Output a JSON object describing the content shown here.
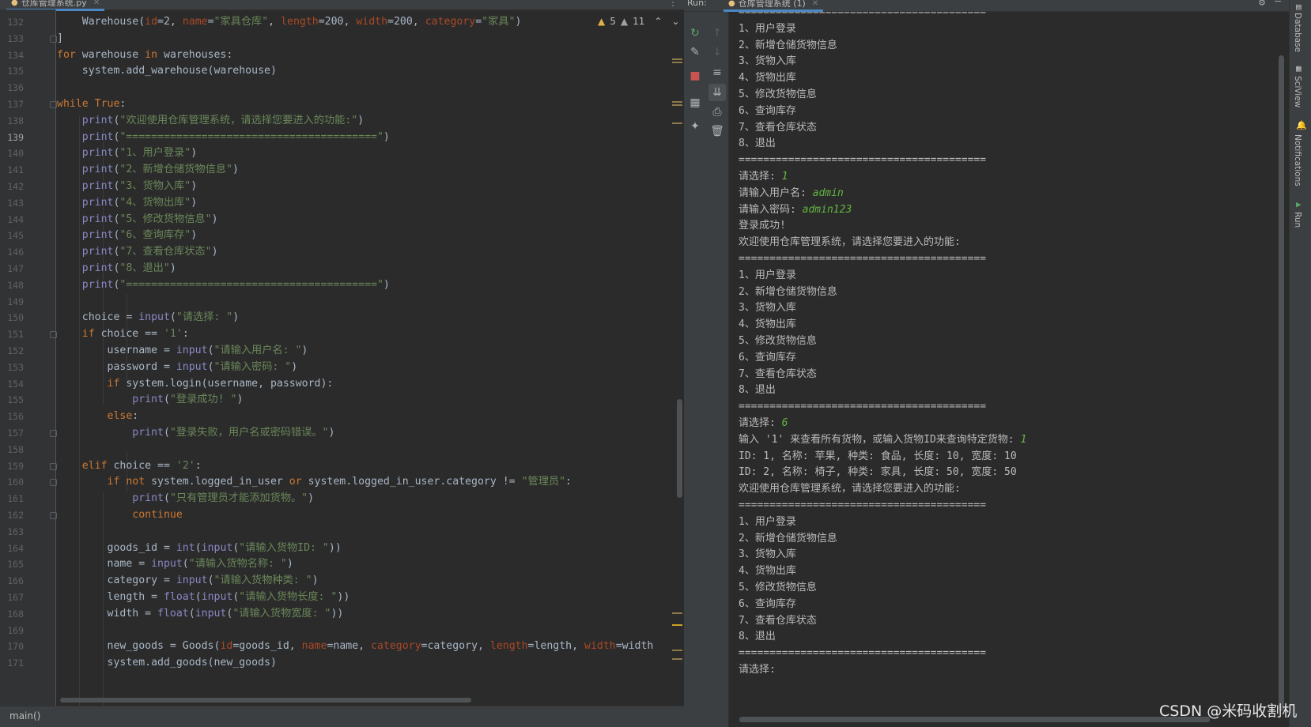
{
  "editor": {
    "tab_label": "仓库管理系统.py",
    "inspection": {
      "warnings": "5",
      "weak_warnings": "11"
    },
    "breadcrumb": "main()",
    "line_numbers": [
      "132",
      "133",
      "134",
      "135",
      "136",
      "137",
      "138",
      "139",
      "140",
      "141",
      "142",
      "143",
      "144",
      "145",
      "146",
      "147",
      "148",
      "149",
      "150",
      "151",
      "152",
      "153",
      "154",
      "155",
      "156",
      "157",
      "158",
      "159",
      "160",
      "161",
      "162",
      "163",
      "164",
      "165",
      "166",
      "167",
      "168",
      "169",
      "170",
      "171"
    ],
    "code_lines": [
      {
        "s": [
          {
            "c": "df",
            "t": "    Warehouse("
          },
          {
            "c": "pm",
            "t": "id"
          },
          {
            "c": "df",
            "t": "=2, "
          },
          {
            "c": "pm",
            "t": "name"
          },
          {
            "c": "df",
            "t": "="
          },
          {
            "c": "st",
            "t": "\"家具仓库\""
          },
          {
            "c": "df",
            "t": ", "
          },
          {
            "c": "pm",
            "t": "length"
          },
          {
            "c": "df",
            "t": "=200, "
          },
          {
            "c": "pm",
            "t": "width"
          },
          {
            "c": "df",
            "t": "=200, "
          },
          {
            "c": "pm",
            "t": "category"
          },
          {
            "c": "df",
            "t": "="
          },
          {
            "c": "st",
            "t": "\"家具\""
          },
          {
            "c": "df",
            "t": ")"
          }
        ]
      },
      {
        "s": [
          {
            "c": "df",
            "t": "]"
          }
        ]
      },
      {
        "s": [
          {
            "c": "kw",
            "t": "for"
          },
          {
            "c": "df",
            "t": " warehouse "
          },
          {
            "c": "kw",
            "t": "in"
          },
          {
            "c": "df",
            "t": " warehouses:"
          }
        ]
      },
      {
        "s": [
          {
            "c": "df",
            "t": "    system.add_warehouse(warehouse)"
          }
        ]
      },
      {
        "s": []
      },
      {
        "s": [
          {
            "c": "kw",
            "t": "while"
          },
          {
            "c": "df",
            "t": " "
          },
          {
            "c": "kw",
            "t": "True"
          },
          {
            "c": "df",
            "t": ":"
          }
        ]
      },
      {
        "s": [
          {
            "c": "bi",
            "t": "    print"
          },
          {
            "c": "df",
            "t": "("
          },
          {
            "c": "st",
            "t": "\"欢迎使用仓库管理系统，请选择您要进入的功能:\""
          },
          {
            "c": "df",
            "t": ")"
          }
        ]
      },
      {
        "s": [
          {
            "c": "bi",
            "t": "    print"
          },
          {
            "c": "df",
            "t": "("
          },
          {
            "c": "st",
            "t": "\"========================================\""
          },
          {
            "c": "df",
            "t": ")"
          }
        ]
      },
      {
        "s": [
          {
            "c": "bi",
            "t": "    print"
          },
          {
            "c": "df",
            "t": "("
          },
          {
            "c": "st",
            "t": "\"1、用户登录\""
          },
          {
            "c": "df",
            "t": ")"
          }
        ]
      },
      {
        "s": [
          {
            "c": "bi",
            "t": "    print"
          },
          {
            "c": "df",
            "t": "("
          },
          {
            "c": "st",
            "t": "\"2、新增仓储货物信息\""
          },
          {
            "c": "df",
            "t": ")"
          }
        ]
      },
      {
        "s": [
          {
            "c": "bi",
            "t": "    print"
          },
          {
            "c": "df",
            "t": "("
          },
          {
            "c": "st",
            "t": "\"3、货物入库\""
          },
          {
            "c": "df",
            "t": ")"
          }
        ]
      },
      {
        "s": [
          {
            "c": "bi",
            "t": "    print"
          },
          {
            "c": "df",
            "t": "("
          },
          {
            "c": "st",
            "t": "\"4、货物出库\""
          },
          {
            "c": "df",
            "t": ")"
          }
        ]
      },
      {
        "s": [
          {
            "c": "bi",
            "t": "    print"
          },
          {
            "c": "df",
            "t": "("
          },
          {
            "c": "st",
            "t": "\"5、修改货物信息\""
          },
          {
            "c": "df",
            "t": ")"
          }
        ]
      },
      {
        "s": [
          {
            "c": "bi",
            "t": "    print"
          },
          {
            "c": "df",
            "t": "("
          },
          {
            "c": "st",
            "t": "\"6、查询库存\""
          },
          {
            "c": "df",
            "t": ")"
          }
        ]
      },
      {
        "s": [
          {
            "c": "bi",
            "t": "    print"
          },
          {
            "c": "df",
            "t": "("
          },
          {
            "c": "st",
            "t": "\"7、查看仓库状态\""
          },
          {
            "c": "df",
            "t": ")"
          }
        ]
      },
      {
        "s": [
          {
            "c": "bi",
            "t": "    print"
          },
          {
            "c": "df",
            "t": "("
          },
          {
            "c": "st",
            "t": "\"8、退出\""
          },
          {
            "c": "df",
            "t": ")"
          }
        ]
      },
      {
        "s": [
          {
            "c": "bi",
            "t": "    print"
          },
          {
            "c": "df",
            "t": "("
          },
          {
            "c": "st",
            "t": "\"========================================\""
          },
          {
            "c": "df",
            "t": ")"
          }
        ]
      },
      {
        "s": []
      },
      {
        "s": [
          {
            "c": "df",
            "t": "    choice = "
          },
          {
            "c": "bi",
            "t": "input"
          },
          {
            "c": "df",
            "t": "("
          },
          {
            "c": "st",
            "t": "\"请选择: \""
          },
          {
            "c": "df",
            "t": ")"
          }
        ]
      },
      {
        "s": [
          {
            "c": "kw",
            "t": "    if"
          },
          {
            "c": "df",
            "t": " choice == "
          },
          {
            "c": "st",
            "t": "'1'"
          },
          {
            "c": "df",
            "t": ":"
          }
        ]
      },
      {
        "s": [
          {
            "c": "df",
            "t": "        username = "
          },
          {
            "c": "bi",
            "t": "input"
          },
          {
            "c": "df",
            "t": "("
          },
          {
            "c": "st",
            "t": "\"请输入用户名: \""
          },
          {
            "c": "df",
            "t": ")"
          }
        ]
      },
      {
        "s": [
          {
            "c": "df",
            "t": "        password = "
          },
          {
            "c": "bi",
            "t": "input"
          },
          {
            "c": "df",
            "t": "("
          },
          {
            "c": "st",
            "t": "\"请输入密码: \""
          },
          {
            "c": "df",
            "t": ")"
          }
        ]
      },
      {
        "s": [
          {
            "c": "kw",
            "t": "        if"
          },
          {
            "c": "df",
            "t": " system.login(username, password):"
          }
        ]
      },
      {
        "s": [
          {
            "c": "bi",
            "t": "            print"
          },
          {
            "c": "df",
            "t": "("
          },
          {
            "c": "st",
            "t": "\"登录成功! \""
          },
          {
            "c": "df",
            "t": ")"
          }
        ]
      },
      {
        "s": [
          {
            "c": "kw",
            "t": "        else"
          },
          {
            "c": "df",
            "t": ":"
          }
        ]
      },
      {
        "s": [
          {
            "c": "bi",
            "t": "            print"
          },
          {
            "c": "df",
            "t": "("
          },
          {
            "c": "st",
            "t": "\"登录失败，用户名或密码错误。\""
          },
          {
            "c": "df",
            "t": ")"
          }
        ]
      },
      {
        "s": []
      },
      {
        "s": [
          {
            "c": "kw",
            "t": "    elif"
          },
          {
            "c": "df",
            "t": " choice == "
          },
          {
            "c": "st",
            "t": "'2'"
          },
          {
            "c": "df",
            "t": ":"
          }
        ]
      },
      {
        "s": [
          {
            "c": "kw",
            "t": "        if not"
          },
          {
            "c": "df",
            "t": " system.logged_in_user "
          },
          {
            "c": "kw",
            "t": "or"
          },
          {
            "c": "df",
            "t": " system.logged_in_user.category != "
          },
          {
            "c": "st",
            "t": "\"管理员\""
          },
          {
            "c": "df",
            "t": ":"
          }
        ]
      },
      {
        "s": [
          {
            "c": "bi",
            "t": "            print"
          },
          {
            "c": "df",
            "t": "("
          },
          {
            "c": "st",
            "t": "\"只有管理员才能添加货物。\""
          },
          {
            "c": "df",
            "t": ")"
          }
        ]
      },
      {
        "s": [
          {
            "c": "kw",
            "t": "            continue"
          }
        ]
      },
      {
        "s": []
      },
      {
        "s": [
          {
            "c": "df",
            "t": "        goods_id = "
          },
          {
            "c": "bi",
            "t": "int"
          },
          {
            "c": "df",
            "t": "("
          },
          {
            "c": "bi",
            "t": "input"
          },
          {
            "c": "df",
            "t": "("
          },
          {
            "c": "st",
            "t": "\"请输入货物ID: \""
          },
          {
            "c": "df",
            "t": "))"
          }
        ]
      },
      {
        "s": [
          {
            "c": "df",
            "t": "        name = "
          },
          {
            "c": "bi",
            "t": "input"
          },
          {
            "c": "df",
            "t": "("
          },
          {
            "c": "st",
            "t": "\"请输入货物名称: \""
          },
          {
            "c": "df",
            "t": ")"
          }
        ]
      },
      {
        "s": [
          {
            "c": "df",
            "t": "        category = "
          },
          {
            "c": "bi",
            "t": "input"
          },
          {
            "c": "df",
            "t": "("
          },
          {
            "c": "st",
            "t": "\"请输入货物种类: \""
          },
          {
            "c": "df",
            "t": ")"
          }
        ]
      },
      {
        "s": [
          {
            "c": "df",
            "t": "        length = "
          },
          {
            "c": "bi",
            "t": "float"
          },
          {
            "c": "df",
            "t": "("
          },
          {
            "c": "bi",
            "t": "input"
          },
          {
            "c": "df",
            "t": "("
          },
          {
            "c": "st",
            "t": "\"请输入货物长度: \""
          },
          {
            "c": "df",
            "t": "))"
          }
        ]
      },
      {
        "s": [
          {
            "c": "df",
            "t": "        width = "
          },
          {
            "c": "bi",
            "t": "float"
          },
          {
            "c": "df",
            "t": "("
          },
          {
            "c": "bi",
            "t": "input"
          },
          {
            "c": "df",
            "t": "("
          },
          {
            "c": "st",
            "t": "\"请输入货物宽度: \""
          },
          {
            "c": "df",
            "t": "))"
          }
        ]
      },
      {
        "s": []
      },
      {
        "s": [
          {
            "c": "df",
            "t": "        new_goods = Goods("
          },
          {
            "c": "pm",
            "t": "id"
          },
          {
            "c": "df",
            "t": "=goods_id, "
          },
          {
            "c": "pm",
            "t": "name"
          },
          {
            "c": "df",
            "t": "=name, "
          },
          {
            "c": "pm",
            "t": "category"
          },
          {
            "c": "df",
            "t": "=category, "
          },
          {
            "c": "pm",
            "t": "length"
          },
          {
            "c": "df",
            "t": "=length, "
          },
          {
            "c": "pm",
            "t": "width"
          },
          {
            "c": "df",
            "t": "=width"
          }
        ]
      },
      {
        "s": [
          {
            "c": "df",
            "t": "        system.add_goods(new_goods)"
          }
        ]
      }
    ]
  },
  "run": {
    "label": "Run:",
    "tab_label": "仓库管理系统 (1)",
    "console_lines": [
      {
        "t": "========================================"
      },
      {
        "t": "1、用户登录"
      },
      {
        "t": "2、新增仓储货物信息"
      },
      {
        "t": "3、货物入库"
      },
      {
        "t": "4、货物出库"
      },
      {
        "t": "5、修改货物信息"
      },
      {
        "t": "6、查询库存"
      },
      {
        "t": "7、查看仓库状态"
      },
      {
        "t": "8、退出"
      },
      {
        "t": "========================================"
      },
      {
        "t": "请选择: ",
        "in": "1"
      },
      {
        "t": "请输入用户名: ",
        "in": "admin"
      },
      {
        "t": "请输入密码: ",
        "in": "admin123"
      },
      {
        "t": "登录成功!"
      },
      {
        "t": "欢迎使用仓库管理系统，请选择您要进入的功能:"
      },
      {
        "t": "========================================"
      },
      {
        "t": "1、用户登录"
      },
      {
        "t": "2、新增仓储货物信息"
      },
      {
        "t": "3、货物入库"
      },
      {
        "t": "4、货物出库"
      },
      {
        "t": "5、修改货物信息"
      },
      {
        "t": "6、查询库存"
      },
      {
        "t": "7、查看仓库状态"
      },
      {
        "t": "8、退出"
      },
      {
        "t": "========================================"
      },
      {
        "t": "请选择: ",
        "in": "6"
      },
      {
        "t": "输入 '1' 来查看所有货物，或输入货物ID来查询特定货物: ",
        "in": "1"
      },
      {
        "t": "ID: 1, 名称: 苹果, 种类: 食品, 长度: 10, 宽度: 10"
      },
      {
        "t": "ID: 2, 名称: 椅子, 种类: 家具, 长度: 50, 宽度: 50"
      },
      {
        "t": "欢迎使用仓库管理系统，请选择您要进入的功能:"
      },
      {
        "t": "========================================"
      },
      {
        "t": "1、用户登录"
      },
      {
        "t": "2、新增仓储货物信息"
      },
      {
        "t": "3、货物入库"
      },
      {
        "t": "4、货物出库"
      },
      {
        "t": "5、修改货物信息"
      },
      {
        "t": "6、查询库存"
      },
      {
        "t": "7、查看仓库状态"
      },
      {
        "t": "8、退出"
      },
      {
        "t": "========================================"
      },
      {
        "t": "请选择: "
      }
    ]
  },
  "right_stripe": {
    "tabs": [
      "Database",
      "SciView",
      "Notifications",
      "Run"
    ]
  },
  "watermark": "CSDN @米码收割机",
  "colors": {
    "keyword": "#cc7832",
    "string": "#6a8759",
    "builtin": "#8888c6",
    "param": "#aa4926",
    "user_input": "#62b543",
    "warning": "#e0b04a"
  }
}
